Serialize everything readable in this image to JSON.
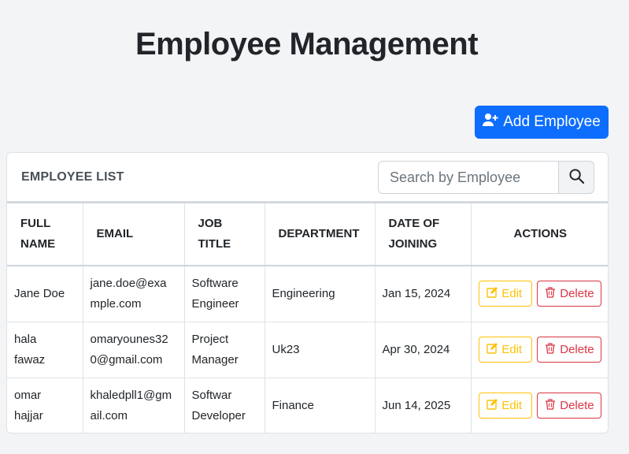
{
  "header": {
    "title": "Employee Management"
  },
  "toolbar": {
    "add_label": "Add Employee"
  },
  "card": {
    "title": "EMPLOYEE LIST"
  },
  "search": {
    "placeholder": "Search by Employee",
    "value": ""
  },
  "table": {
    "columns": {
      "name_line1": "FULL",
      "name_line2": "NAME",
      "email": "EMAIL",
      "job_line1": "JOB",
      "job_line2": "TITLE",
      "department": "DEPARTMENT",
      "doj_line1": "DATE OF",
      "doj_line2": "JOINING",
      "actions": "ACTIONS"
    },
    "rows": [
      {
        "name1": "Jane Doe",
        "name2": "",
        "email1": "jane.doe@exa",
        "email2": "mple.com",
        "job1": "Software",
        "job2": "Engineer",
        "department": "Engineering",
        "date": "Jan 15, 2024"
      },
      {
        "name1": "hala",
        "name2": "fawaz",
        "email1": "omaryounes32",
        "email2": "0@gmail.com",
        "job1": "Project",
        "job2": "Manager",
        "department": "Uk23",
        "date": "Apr 30, 2024"
      },
      {
        "name1": "omar",
        "name2": "hajjar",
        "email1": "khaledpll1@gm",
        "email2": "ail.com",
        "job1": "Softwar",
        "job2": "Developer",
        "department": "Finance",
        "date": "Jun 14, 2025"
      }
    ],
    "edit_label": "Edit",
    "delete_label": "Delete"
  },
  "colors": {
    "primary": "#0d6efd",
    "warning": "#ffc107",
    "danger": "#dc3545"
  },
  "icons": {
    "add": "user-plus-icon",
    "search": "search-icon",
    "edit": "edit-icon",
    "delete": "trash-icon"
  }
}
